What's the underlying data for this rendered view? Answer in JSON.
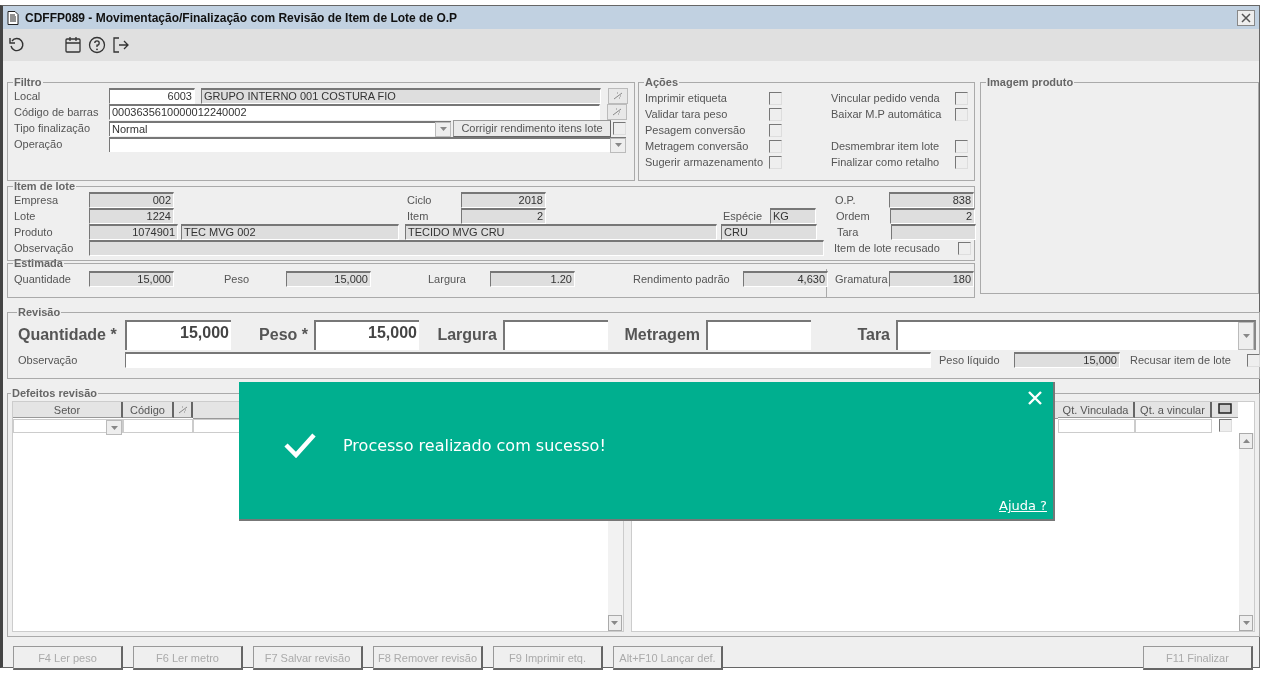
{
  "window": {
    "title": "CDFFP089 - Movimentação/Finalização com Revisão de Item de Lote de O.P"
  },
  "filtro": {
    "title": "Filtro",
    "local": {
      "label": "Local",
      "code": "6003",
      "description": "GRUPO INTERNO 001 COSTURA FIO"
    },
    "codigo_barras": {
      "label": "Código de barras",
      "value": "0003635610000012240002"
    },
    "tipo_finalizacao": {
      "label": "Tipo finalização",
      "value": "Normal"
    },
    "corrigir_rendimento": {
      "label": "Corrigir rendimento itens lote",
      "checked": false
    },
    "operacao": {
      "label": "Operação"
    }
  },
  "acoes": {
    "title": "Ações",
    "column_1": [
      {
        "label": "Imprimir etiqueta",
        "checked": false
      },
      {
        "label": "Validar tara peso",
        "checked": false
      },
      {
        "label": "Pesagem conversão",
        "checked": false
      },
      {
        "label": "Metragem conversão",
        "checked": false
      },
      {
        "label": "Sugerir armazenamento",
        "checked": false
      }
    ],
    "column_2": [
      {
        "label": "Vincular pedido venda",
        "checked": false
      },
      {
        "label": "Baixar M.P automática",
        "checked": false
      },
      {
        "label": "Desmembrar item lote",
        "checked": false
      },
      {
        "label": "Finalizar como retalho",
        "checked": false
      }
    ]
  },
  "imagem_produto": {
    "title": "Imagem produto"
  },
  "item_lote": {
    "title": "Item de lote",
    "empresa": {
      "label": "Empresa",
      "value": "002"
    },
    "ciclo": {
      "label": "Ciclo",
      "value": "2018"
    },
    "op": {
      "label": "O.P.",
      "value": "838"
    },
    "lote": {
      "label": "Lote",
      "value": "1224"
    },
    "item": {
      "label": "Item",
      "value": "2"
    },
    "especie": {
      "label": "Espécie",
      "value": "KG"
    },
    "ordem": {
      "label": "Ordem",
      "value": "2"
    },
    "produto": {
      "label": "Produto",
      "code": "1074901",
      "name": "TEC MVG 002",
      "description": "TECIDO MVG CRU",
      "finish": "CRU"
    },
    "tara": {
      "label": "Tara"
    },
    "observacao": {
      "label": "Observação"
    },
    "recusado": {
      "label": "Item de lote recusado",
      "checked": false
    }
  },
  "estimada": {
    "title": "Estimada",
    "quantidade": {
      "label": "Quantidade",
      "value": "15,000"
    },
    "peso": {
      "label": "Peso",
      "value": "15,000"
    },
    "largura": {
      "label": "Largura",
      "value": "1.20"
    },
    "rendimento_padrao": {
      "label": "Rendimento padrão",
      "value": "4,630"
    },
    "gramatura": {
      "label": "Gramatura",
      "value": "180"
    }
  },
  "revisao": {
    "title": "Revisão",
    "quantidade": {
      "label": "Quantidade *",
      "value": "15,000"
    },
    "peso": {
      "label": "Peso *",
      "value": "15,000"
    },
    "largura": {
      "label": "Largura"
    },
    "metragem": {
      "label": "Metragem"
    },
    "tara": {
      "label": "Tara"
    },
    "observacao": {
      "label": "Observação"
    },
    "peso_liquido": {
      "label": "Peso líquido",
      "value": "15,000"
    },
    "recusar": {
      "label": "Recusar item de lote",
      "checked": false
    }
  },
  "defeitos": {
    "title": "Defeitos revisão",
    "left_columns": [
      "Setor",
      "Código"
    ],
    "right_columns": [
      "Qt. Vinculada",
      "Qt. a vincular"
    ],
    "row": {
      "checked": false
    }
  },
  "toast": {
    "message": "Processo realizado com sucesso!",
    "link": "Ajuda ?"
  },
  "buttons": [
    {
      "label": "F4 Ler peso",
      "disabled": true
    },
    {
      "label": "F6 Ler metro",
      "disabled": true
    },
    {
      "label": "F7 Salvar revisão",
      "disabled": true
    },
    {
      "label": "F8 Remover revisão",
      "disabled": true
    },
    {
      "label": "F9 Imprimir etq.",
      "disabled": true
    },
    {
      "label": "Alt+F10 Lançar def.",
      "disabled": true
    },
    {
      "label": "F11 Finalizar",
      "disabled": true
    }
  ]
}
